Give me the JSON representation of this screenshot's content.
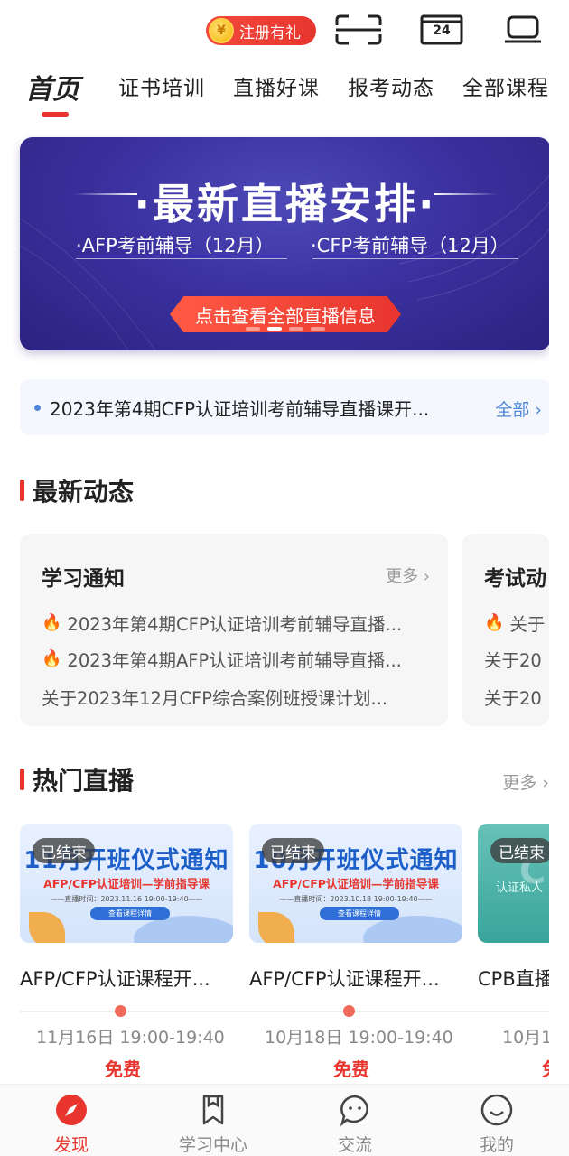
{
  "header": {
    "register_badge": "注册有礼",
    "coin_symbol": "¥",
    "calendar_day": "24",
    "icons": [
      "scan-icon",
      "calendar-icon",
      "tv-icon"
    ]
  },
  "tabs": [
    {
      "label": "首页",
      "active": true
    },
    {
      "label": "证书培训"
    },
    {
      "label": "直播好课"
    },
    {
      "label": "报考动态"
    },
    {
      "label": "全部课程"
    }
  ],
  "banner": {
    "title": "·最新直播安排·",
    "sub_left": "·AFP考前辅导（12月）",
    "sub_right": "·CFP考前辅导（12月）",
    "cta": "点击查看全部直播信息"
  },
  "notice": {
    "text": "2023年第4期CFP认证培训考前辅导直播课开...",
    "all_label": "全部 ›"
  },
  "latest": {
    "title": "最新动态",
    "cards": [
      {
        "title": "学习通知",
        "more": "更多 ›",
        "items": [
          {
            "text": "2023年第4期CFP认证培训考前辅导直播...",
            "hot": true
          },
          {
            "text": "2023年第4期AFP认证培训考前辅导直播...",
            "hot": true
          },
          {
            "text": "关于2023年12月CFP综合案例班授课计划...",
            "hot": false
          }
        ]
      },
      {
        "title": "考试动",
        "items": [
          {
            "text": "关于",
            "hot": true
          },
          {
            "text": "关于20",
            "hot": false
          },
          {
            "text": "关于20",
            "hot": false
          }
        ]
      }
    ]
  },
  "hot_live": {
    "title": "热门直播",
    "more": "更多 ›",
    "items": [
      {
        "status": "已结束",
        "thumb_headline": "11月开班仪式通知",
        "thumb_sub": "AFP/CFP认证培训—学前指导课",
        "thumb_time": "——直播时间：2023.11.16 19:00-19:40——",
        "thumb_btn": "查看课程详情",
        "name": "AFP/CFP认证课程开...",
        "time": "11月16日 19:00-19:40",
        "price": "免费"
      },
      {
        "status": "已结束",
        "thumb_headline": "10月开班仪式通知",
        "thumb_sub": "AFP/CFP认证培训—学前指导课",
        "thumb_time": "——直播时间：2023.10.18 19:00-19:40——",
        "thumb_btn": "查看课程详情",
        "name": "AFP/CFP认证课程开...",
        "time": "10月18日 19:00-19:40",
        "price": "免费"
      },
      {
        "status": "已结束",
        "thumb_headline": "CP",
        "thumb_sub": "认证私人",
        "name": "CPB直播",
        "time": "10月1",
        "price": "免"
      }
    ]
  },
  "bottom_nav": [
    {
      "label": "发现",
      "icon": "compass-icon",
      "active": true
    },
    {
      "label": "学习中心",
      "icon": "bookmark-icon"
    },
    {
      "label": "交流",
      "icon": "chat-icon"
    },
    {
      "label": "我的",
      "icon": "smile-icon"
    }
  ],
  "colors": {
    "accent": "#e8352e",
    "link": "#4f86d9",
    "banner": "#3b31a0"
  }
}
